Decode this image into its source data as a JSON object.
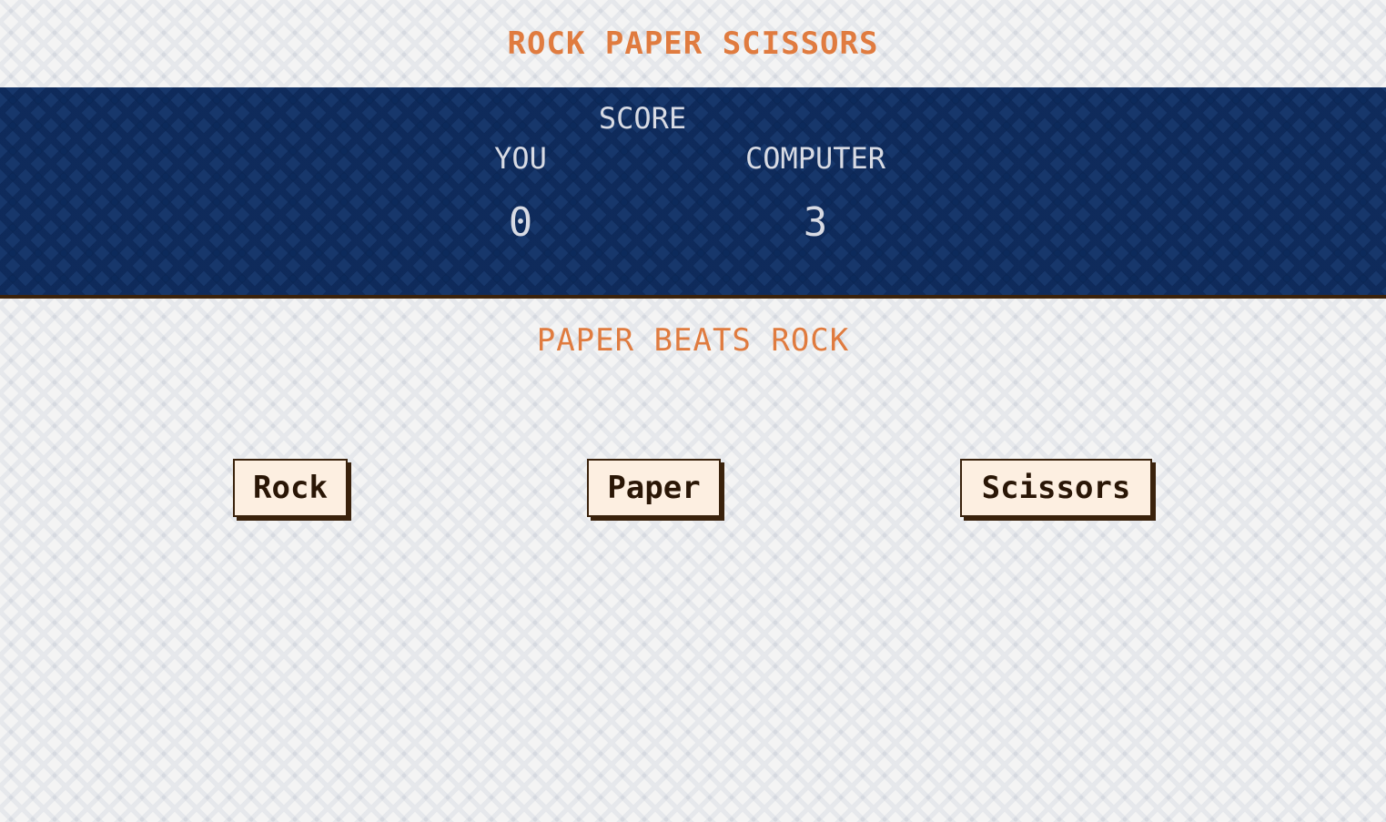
{
  "game": {
    "title": "ROCK PAPER SCISSORS"
  },
  "scoreboard": {
    "heading": "SCORE",
    "player": {
      "label": "YOU",
      "score": "0"
    },
    "computer": {
      "label": "COMPUTER",
      "score": "3"
    }
  },
  "result": {
    "message": "PAPER BEATS ROCK"
  },
  "choices": [
    {
      "label": "Rock"
    },
    {
      "label": "Paper"
    },
    {
      "label": "Scissors"
    }
  ],
  "colors": {
    "accent": "#e07b3f",
    "scoreboard_bg": "#17376b",
    "button_bg": "#fdefe1",
    "button_border": "#3a220c",
    "score_text": "#d8dbe4"
  }
}
